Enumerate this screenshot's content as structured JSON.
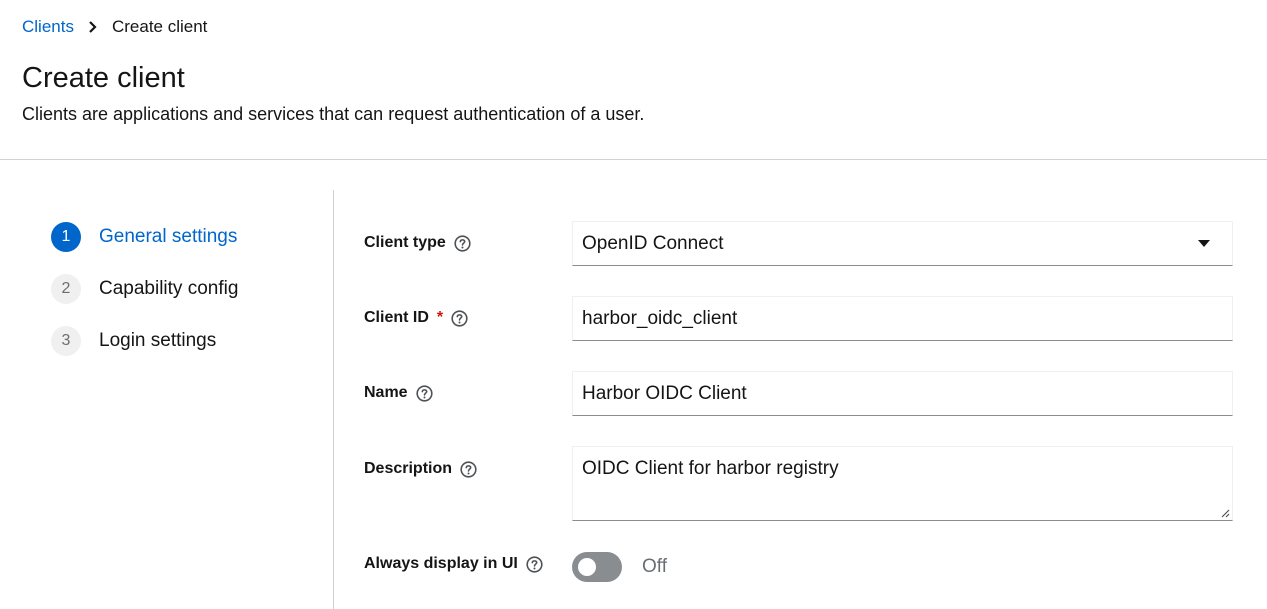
{
  "breadcrumb": {
    "parent": "Clients",
    "current": "Create client"
  },
  "header": {
    "title": "Create client",
    "description": "Clients are applications and services that can request authentication of a user."
  },
  "wizard": {
    "steps": [
      {
        "number": "1",
        "label": "General settings",
        "active": true
      },
      {
        "number": "2",
        "label": "Capability config",
        "active": false
      },
      {
        "number": "3",
        "label": "Login settings",
        "active": false
      }
    ]
  },
  "form": {
    "client_type": {
      "label": "Client type",
      "value": "OpenID Connect"
    },
    "client_id": {
      "label": "Client ID",
      "required_mark": "*",
      "value": "harbor_oidc_client"
    },
    "name": {
      "label": "Name",
      "value": "Harbor OIDC Client"
    },
    "description": {
      "label": "Description",
      "value": "OIDC Client for harbor registry"
    },
    "always_display": {
      "label": "Always display in UI",
      "state": "Off"
    }
  },
  "colors": {
    "link": "#0066cc",
    "active_step": "#0066cc",
    "required": "#c9190b",
    "toggle_off": "#8a8d90",
    "divider": "#d2d2d2"
  },
  "icons": [
    "chevron-right-icon",
    "help-icon",
    "caret-down-icon",
    "resize-grip-icon"
  ]
}
